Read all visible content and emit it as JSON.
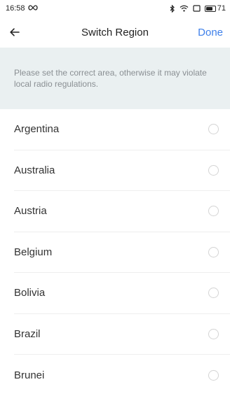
{
  "status_bar": {
    "time": "16:58",
    "battery_level": "71",
    "battery_fraction": 0.71,
    "icons": [
      "infinity-icon",
      "bluetooth-icon",
      "wifi-icon",
      "screen-icon",
      "battery-icon"
    ]
  },
  "header": {
    "back_icon": "arrow-left-icon",
    "title": "Switch Region",
    "done_label": "Done"
  },
  "notice": {
    "text": "Please set the correct area, otherwise it may violate local radio regulations."
  },
  "regions": [
    {
      "label": "Argentina",
      "selected": false
    },
    {
      "label": "Australia",
      "selected": false
    },
    {
      "label": "Austria",
      "selected": false
    },
    {
      "label": "Belgium",
      "selected": false
    },
    {
      "label": "Bolivia",
      "selected": false
    },
    {
      "label": "Brazil",
      "selected": false
    },
    {
      "label": "Brunei",
      "selected": false
    }
  ],
  "colors": {
    "accent": "#3f80ea",
    "notice_bg": "#eaf0f1",
    "notice_text": "#8a8f93"
  }
}
